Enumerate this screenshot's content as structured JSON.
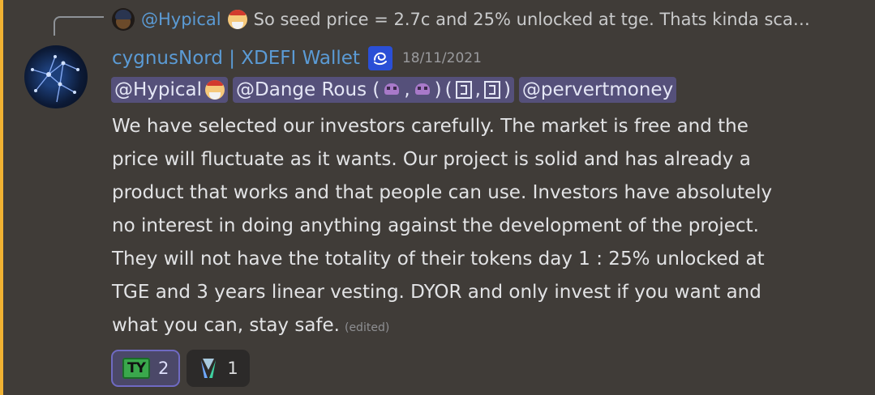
{
  "reply": {
    "username": "@Hypical",
    "text": "So seed price = 2.7c and 25% unlocked at tge. Thats kinda sca…"
  },
  "message": {
    "username": "cygnusNord | XDEFI Wallet",
    "timestamp": "18/11/2021",
    "mentions": [
      {
        "label": "@Hypical"
      },
      {
        "label": "@Dange Rous ("
      },
      {
        "label": "@pervertmoney"
      }
    ],
    "mention_parts": {
      "comma": ",",
      "close_paren": ")",
      "open_paren": "(",
      "sep": ","
    },
    "lines": [
      "We have selected our investors carefully. The market is free and the",
      "price will fluctuate as it wants. Our project is solid and has already a",
      "product that works and that people can use. Investors have absolutely",
      "no interest in doing anything against the development of the project.",
      "They will not have the totality of their tokens day 1 : 25% unlocked at",
      "TGE and 3 years linear vesting. DYOR and only invest if you want and",
      "what you can, stay safe."
    ],
    "edited_label": "(edited)"
  },
  "reactions": [
    {
      "icon": "ty-emoji-icon",
      "label": "TY",
      "count": "2",
      "active": true
    },
    {
      "icon": "xdefi-emoji-icon",
      "count": "1",
      "active": false
    }
  ],
  "colors": {
    "background": "#403c38",
    "username": "#5b9bd5",
    "mention_bg": "#55507a",
    "accent_bar": "#f0b232"
  }
}
